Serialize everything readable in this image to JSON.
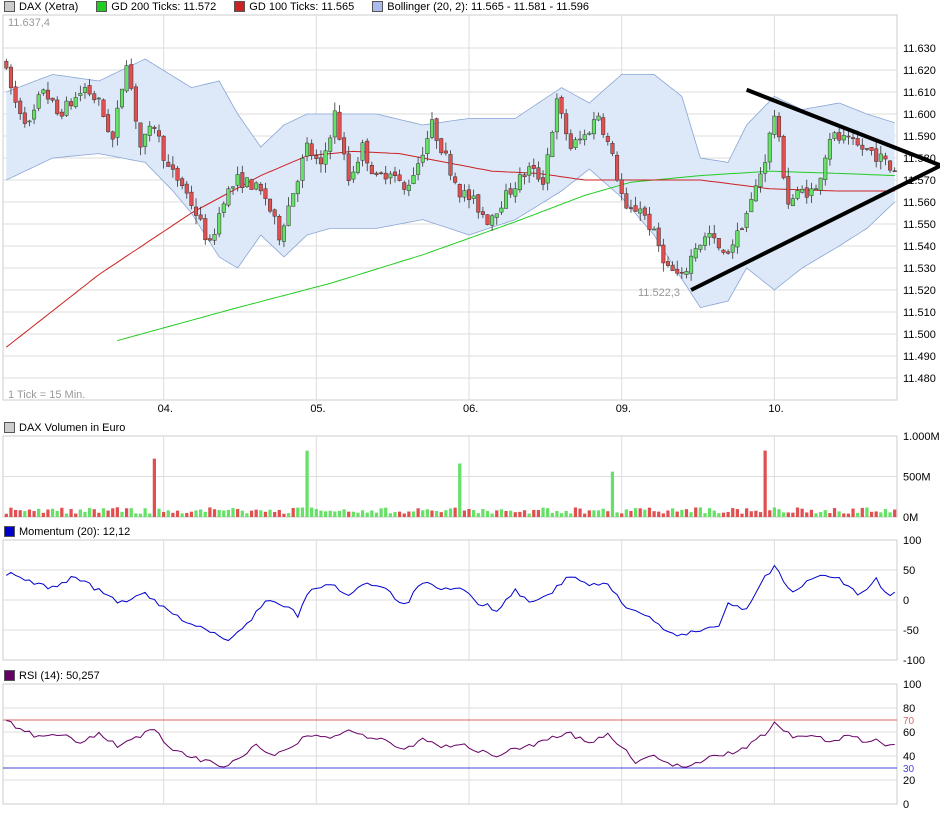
{
  "colors": {
    "up": "#66e066",
    "down": "#e05050",
    "candle_outline": "#333333",
    "gd200": "#22cc22",
    "gd100": "#cc2222",
    "band_fill": "#dde8f8",
    "band_line": "#8aa6d6",
    "grid": "#dddddd",
    "frame": "#cccccc",
    "momentum": "#0000cc",
    "rsi": "#660066",
    "rsi_70": "#dd6666",
    "rsi_30": "#4444dd",
    "trendline": "#000000"
  },
  "legend": {
    "main": [
      {
        "label": "DAX (Xetra)",
        "color": "#cccccc"
      },
      {
        "label": "GD 200 Ticks: 11.572",
        "color": "#22cc22"
      },
      {
        "label": "GD 100 Ticks: 11.565",
        "color": "#cc2222"
      },
      {
        "label": "Bollinger (20, 2): 11.565 - 11.581 - 11.596",
        "color": "#aabbee"
      }
    ],
    "volume": {
      "label": "DAX Volumen in Euro",
      "color": "#cccccc"
    },
    "momentum": {
      "label": "Momentum (20): 12,12",
      "color": "#0000cc"
    },
    "rsi": {
      "label": "RSI (14): 50,257",
      "color": "#660066"
    }
  },
  "chart_data": [
    {
      "type": "candlestick",
      "title": "DAX (Xetra)",
      "interval_note": "1 Tick = 15 Min.",
      "high_label": "11.637,4",
      "low_label": "11.522,3",
      "ylim": [
        11470,
        11645
      ],
      "yticks": [
        "11.480",
        "11.490",
        "11.500",
        "11.510",
        "11.520",
        "11.530",
        "11.540",
        "11.550",
        "11.560",
        "11.570",
        "11.580",
        "11.590",
        "11.600",
        "11.610",
        "11.620",
        "11.630"
      ],
      "ytick_values": [
        11480,
        11490,
        11500,
        11510,
        11520,
        11530,
        11540,
        11550,
        11560,
        11570,
        11580,
        11590,
        11600,
        11610,
        11620,
        11630
      ],
      "xticks": [
        "04.",
        "05.",
        "06.",
        "09.",
        "10."
      ],
      "xtick_index": [
        34,
        67,
        100,
        133,
        166
      ],
      "n_ticks": 193,
      "keypoints": [
        [
          0,
          11625
        ],
        [
          3,
          11605
        ],
        [
          6,
          11595
        ],
        [
          9,
          11612
        ],
        [
          12,
          11600
        ],
        [
          15,
          11605
        ],
        [
          18,
          11612
        ],
        [
          21,
          11605
        ],
        [
          24,
          11588
        ],
        [
          27,
          11625
        ],
        [
          30,
          11585
        ],
        [
          33,
          11595
        ],
        [
          36,
          11575
        ],
        [
          39,
          11568
        ],
        [
          42,
          11555
        ],
        [
          45,
          11540
        ],
        [
          48,
          11562
        ],
        [
          51,
          11570
        ],
        [
          54,
          11568
        ],
        [
          57,
          11562
        ],
        [
          60,
          11545
        ],
        [
          63,
          11565
        ],
        [
          66,
          11585
        ],
        [
          69,
          11575
        ],
        [
          72,
          11600
        ],
        [
          75,
          11570
        ],
        [
          78,
          11585
        ],
        [
          81,
          11570
        ],
        [
          84,
          11575
        ],
        [
          87,
          11565
        ],
        [
          90,
          11578
        ],
        [
          93,
          11595
        ],
        [
          96,
          11580
        ],
        [
          99,
          11565
        ],
        [
          102,
          11560
        ],
        [
          105,
          11552
        ],
        [
          108,
          11560
        ],
        [
          111,
          11568
        ],
        [
          114,
          11575
        ],
        [
          117,
          11570
        ],
        [
          120,
          11605
        ],
        [
          123,
          11585
        ],
        [
          126,
          11590
        ],
        [
          129,
          11600
        ],
        [
          132,
          11580
        ],
        [
          135,
          11555
        ],
        [
          138,
          11558
        ],
        [
          141,
          11545
        ],
        [
          144,
          11530
        ],
        [
          147,
          11525
        ],
        [
          150,
          11540
        ],
        [
          153,
          11545
        ],
        [
          156,
          11535
        ],
        [
          159,
          11545
        ],
        [
          162,
          11560
        ],
        [
          165,
          11580
        ],
        [
          167,
          11600
        ],
        [
          170,
          11560
        ],
        [
          173,
          11565
        ],
        [
          176,
          11565
        ],
        [
          179,
          11590
        ],
        [
          182,
          11588
        ],
        [
          185,
          11585
        ],
        [
          188,
          11583
        ],
        [
          191,
          11578
        ],
        [
          192,
          11575
        ]
      ],
      "band_up_keypoints": [
        [
          0,
          11610
        ],
        [
          10,
          11618
        ],
        [
          20,
          11615
        ],
        [
          30,
          11625
        ],
        [
          40,
          11612
        ],
        [
          46,
          11615
        ],
        [
          50,
          11600
        ],
        [
          55,
          11585
        ],
        [
          60,
          11595
        ],
        [
          65,
          11600
        ],
        [
          70,
          11600
        ],
        [
          80,
          11600
        ],
        [
          90,
          11595
        ],
        [
          100,
          11598
        ],
        [
          110,
          11598
        ],
        [
          120,
          11612
        ],
        [
          126,
          11605
        ],
        [
          133,
          11618
        ],
        [
          140,
          11618
        ],
        [
          146,
          11608
        ],
        [
          150,
          11580
        ],
        [
          156,
          11578
        ],
        [
          160,
          11595
        ],
        [
          166,
          11608
        ],
        [
          172,
          11602
        ],
        [
          180,
          11605
        ],
        [
          186,
          11600
        ],
        [
          192,
          11596
        ]
      ],
      "band_low_keypoints": [
        [
          0,
          11570
        ],
        [
          10,
          11580
        ],
        [
          20,
          11582
        ],
        [
          30,
          11578
        ],
        [
          36,
          11565
        ],
        [
          40,
          11555
        ],
        [
          46,
          11535
        ],
        [
          50,
          11530
        ],
        [
          55,
          11545
        ],
        [
          60,
          11535
        ],
        [
          65,
          11545
        ],
        [
          70,
          11548
        ],
        [
          80,
          11548
        ],
        [
          90,
          11552
        ],
        [
          100,
          11545
        ],
        [
          110,
          11552
        ],
        [
          120,
          11565
        ],
        [
          126,
          11575
        ],
        [
          133,
          11562
        ],
        [
          140,
          11545
        ],
        [
          146,
          11525
        ],
        [
          150,
          11512
        ],
        [
          156,
          11515
        ],
        [
          160,
          11530
        ],
        [
          166,
          11520
        ],
        [
          172,
          11530
        ],
        [
          180,
          11540
        ],
        [
          186,
          11548
        ],
        [
          192,
          11560
        ]
      ],
      "gd200": {
        "start": 24,
        "points": [
          [
            24,
            11497
          ],
          [
            50,
            11512
          ],
          [
            70,
            11523
          ],
          [
            90,
            11536
          ],
          [
            110,
            11551
          ],
          [
            125,
            11563
          ],
          [
            135,
            11569
          ],
          [
            150,
            11572
          ],
          [
            165,
            11574
          ],
          [
            180,
            11573
          ],
          [
            192,
            11572
          ]
        ]
      },
      "gd100": {
        "start": 0,
        "points": [
          [
            0,
            11494
          ],
          [
            20,
            11527
          ],
          [
            40,
            11555
          ],
          [
            55,
            11572
          ],
          [
            65,
            11581
          ],
          [
            75,
            11583
          ],
          [
            85,
            11582
          ],
          [
            95,
            11578
          ],
          [
            105,
            11574
          ],
          [
            115,
            11573
          ],
          [
            125,
            11570
          ],
          [
            135,
            11570
          ],
          [
            150,
            11570
          ],
          [
            165,
            11566
          ],
          [
            180,
            11565
          ],
          [
            192,
            11565
          ]
        ]
      },
      "trendlines": [
        {
          "from": [
            160,
            11611
          ],
          "to": [
            210,
            11570
          ]
        },
        {
          "from": [
            148,
            11520
          ],
          "to": [
            210,
            11585
          ]
        }
      ]
    },
    {
      "type": "bar",
      "title": "DAX Volumen in Euro",
      "ylim": [
        0,
        1000
      ],
      "yticks": [
        "0M",
        "500M",
        "1.000M"
      ],
      "ytick_values": [
        0,
        500,
        1000
      ],
      "spikes": [
        [
          32,
          720
        ],
        [
          65,
          820
        ],
        [
          98,
          660
        ],
        [
          131,
          560
        ],
        [
          164,
          820
        ]
      ],
      "base_range": [
        40,
        120
      ]
    },
    {
      "type": "line",
      "title": "Momentum (20)",
      "last_value": "12,12",
      "ylim": [
        -100,
        100
      ],
      "yticks": [
        "-100",
        "-50",
        "0",
        "50",
        "100"
      ],
      "ytick_values": [
        -100,
        -50,
        0,
        50,
        100
      ],
      "keypoints": [
        [
          0,
          45
        ],
        [
          5,
          30
        ],
        [
          10,
          20
        ],
        [
          15,
          40
        ],
        [
          20,
          15
        ],
        [
          25,
          -5
        ],
        [
          30,
          10
        ],
        [
          35,
          -20
        ],
        [
          40,
          -40
        ],
        [
          45,
          -55
        ],
        [
          48,
          -70
        ],
        [
          52,
          -40
        ],
        [
          56,
          0
        ],
        [
          60,
          -10
        ],
        [
          63,
          -25
        ],
        [
          66,
          20
        ],
        [
          70,
          25
        ],
        [
          74,
          10
        ],
        [
          78,
          30
        ],
        [
          82,
          20
        ],
        [
          86,
          -10
        ],
        [
          90,
          30
        ],
        [
          94,
          15
        ],
        [
          98,
          20
        ],
        [
          102,
          -5
        ],
        [
          106,
          -15
        ],
        [
          110,
          15
        ],
        [
          114,
          -5
        ],
        [
          118,
          15
        ],
        [
          122,
          40
        ],
        [
          126,
          25
        ],
        [
          130,
          25
        ],
        [
          134,
          -10
        ],
        [
          138,
          -25
        ],
        [
          142,
          -50
        ],
        [
          146,
          -60
        ],
        [
          150,
          -50
        ],
        [
          154,
          -40
        ],
        [
          156,
          -5
        ],
        [
          160,
          -15
        ],
        [
          164,
          40
        ],
        [
          166,
          55
        ],
        [
          170,
          10
        ],
        [
          173,
          30
        ],
        [
          176,
          45
        ],
        [
          180,
          35
        ],
        [
          184,
          10
        ],
        [
          186,
          15
        ],
        [
          188,
          35
        ],
        [
          190,
          10
        ],
        [
          192,
          12
        ]
      ]
    },
    {
      "type": "line",
      "title": "RSI (14)",
      "last_value": "50,257",
      "ylim": [
        0,
        100
      ],
      "yticks": [
        "0",
        "20",
        "40",
        "60",
        "80",
        "100"
      ],
      "ytick_values": [
        0,
        20,
        40,
        60,
        80,
        100
      ],
      "ref_lines": [
        {
          "value": 70,
          "label": "70"
        },
        {
          "value": 30,
          "label": "30"
        }
      ],
      "keypoints": [
        [
          0,
          70
        ],
        [
          4,
          60
        ],
        [
          8,
          55
        ],
        [
          12,
          58
        ],
        [
          16,
          50
        ],
        [
          20,
          60
        ],
        [
          24,
          48
        ],
        [
          28,
          55
        ],
        [
          32,
          62
        ],
        [
          36,
          45
        ],
        [
          40,
          38
        ],
        [
          44,
          36
        ],
        [
          46,
          30
        ],
        [
          50,
          38
        ],
        [
          54,
          48
        ],
        [
          58,
          42
        ],
        [
          62,
          50
        ],
        [
          66,
          58
        ],
        [
          70,
          55
        ],
        [
          74,
          62
        ],
        [
          78,
          56
        ],
        [
          82,
          52
        ],
        [
          86,
          45
        ],
        [
          90,
          55
        ],
        [
          94,
          48
        ],
        [
          98,
          50
        ],
        [
          102,
          44
        ],
        [
          106,
          40
        ],
        [
          110,
          46
        ],
        [
          114,
          50
        ],
        [
          118,
          55
        ],
        [
          122,
          58
        ],
        [
          126,
          52
        ],
        [
          130,
          58
        ],
        [
          134,
          45
        ],
        [
          136,
          35
        ],
        [
          140,
          40
        ],
        [
          144,
          33
        ],
        [
          148,
          32
        ],
        [
          152,
          38
        ],
        [
          156,
          42
        ],
        [
          160,
          48
        ],
        [
          164,
          58
        ],
        [
          166,
          68
        ],
        [
          170,
          55
        ],
        [
          174,
          58
        ],
        [
          178,
          52
        ],
        [
          182,
          58
        ],
        [
          186,
          52
        ],
        [
          188,
          55
        ],
        [
          190,
          48
        ],
        [
          192,
          50
        ]
      ]
    }
  ]
}
